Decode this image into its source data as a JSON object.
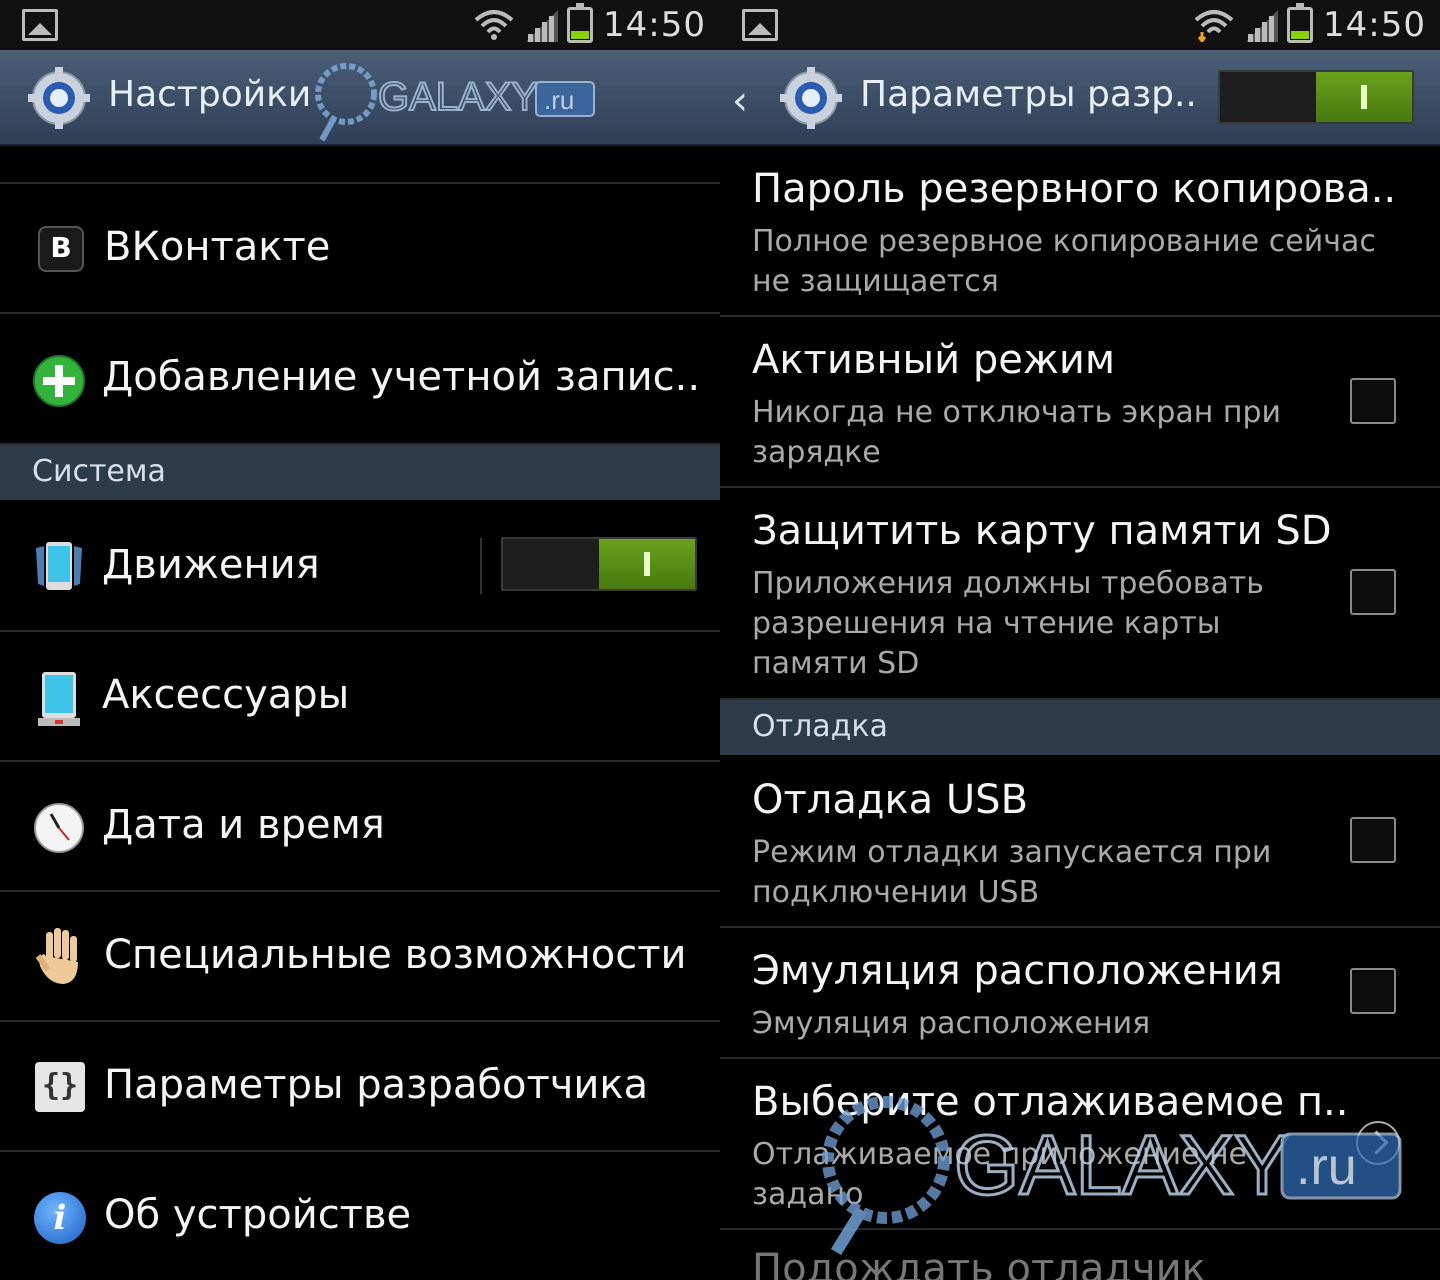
{
  "status_bar": {
    "time": "14:50"
  },
  "left": {
    "title": "Настройки",
    "watermark": {
      "text": "GALAXY",
      "badge": ".ru"
    },
    "items_top": [
      {
        "label": "ВКонтакте",
        "icon": "vk-icon"
      },
      {
        "label": "Добавление учетной запис..",
        "icon": "add-account-icon"
      }
    ],
    "section": "Система",
    "items": [
      {
        "label": "Движения",
        "icon": "motion-icon",
        "toggle": true
      },
      {
        "label": "Аксессуары",
        "icon": "accessory-icon"
      },
      {
        "label": "Дата и время",
        "icon": "clock-icon"
      },
      {
        "label": "Специальные возможности",
        "icon": "hand-icon"
      },
      {
        "label": "Параметры разработчика",
        "icon": "braces-icon"
      },
      {
        "label": "Об устройстве",
        "icon": "info-icon"
      }
    ],
    "vk_letter": "В",
    "braces_glyph": "{}",
    "info_glyph": "i"
  },
  "right": {
    "title": "Параметры разр..",
    "master_toggle": true,
    "items": [
      {
        "title": "Пароль резервного копирова..",
        "summary_lines": [
          "Полное резервное копирование сейчас",
          "не защищается"
        ]
      },
      {
        "title": "Активный режим",
        "summary_lines": [
          "Никогда не отключать экран при",
          "зарядке"
        ],
        "checked": false
      },
      {
        "title": "Защитить карту памяти SD",
        "summary_lines": [
          "Приложения должны требовать",
          "разрешения на чтение карты",
          "памяти SD"
        ],
        "checked": false
      }
    ],
    "section": "Отладка",
    "debug_items": [
      {
        "title": "Отладка USB",
        "summary_lines": [
          "Режим отладки запускается при",
          "подключении USB"
        ],
        "checked": false
      },
      {
        "title": "Эмуляция расположения",
        "summary_lines": [
          "Эмуляция расположения"
        ],
        "checked": false
      },
      {
        "title": "Выберите отлаживаемое п..",
        "summary_lines": [
          "Отлаживаемое приложение не",
          "задано"
        ]
      },
      {
        "title": "Подождать отладчик"
      }
    ],
    "watermark": {
      "text": "GALAXY",
      "badge": ".ru"
    }
  },
  "colors": {
    "actionbar": "#3d506a",
    "section": "#2d3b4b",
    "toggle_on": "#5a8f16",
    "battery": "#8bd000"
  }
}
